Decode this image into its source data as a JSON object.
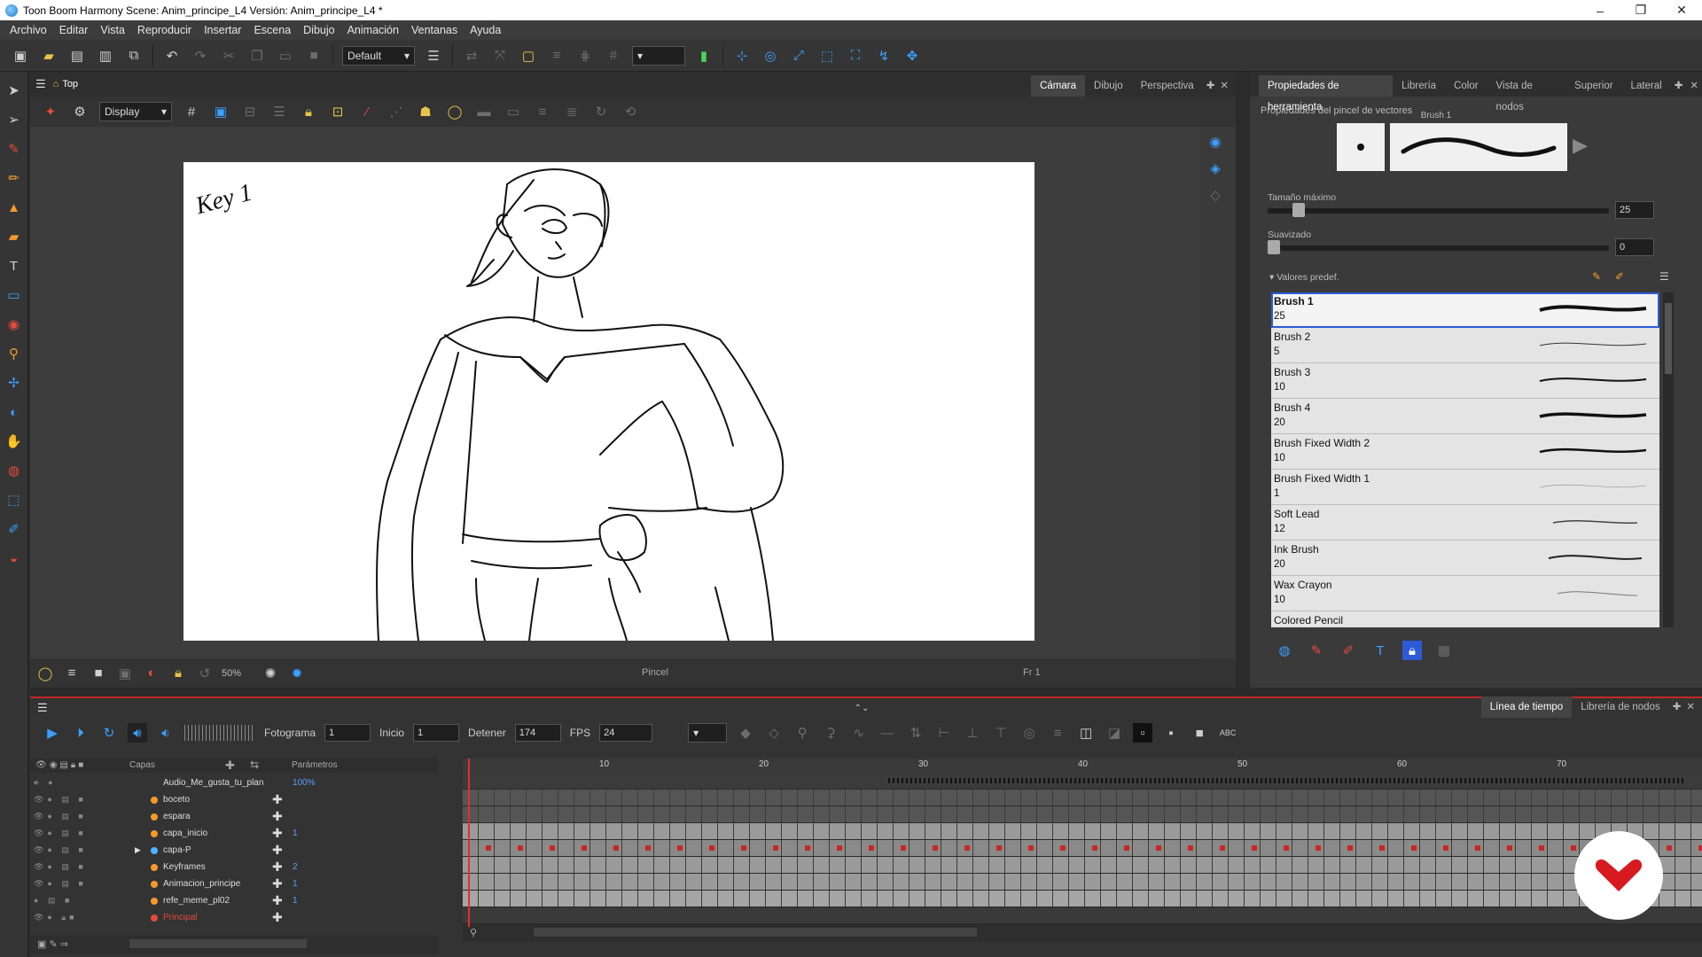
{
  "window": {
    "title": "Toon Boom Harmony Scene: Anim_principe_L4 Versión: Anim_principe_L4 *",
    "min": "–",
    "max": "❐",
    "close": "✕"
  },
  "menu": [
    "Archivo",
    "Editar",
    "Vista",
    "Reproducir",
    "Insertar",
    "Escena",
    "Dibujo",
    "Animación",
    "Ventanas",
    "Ayuda"
  ],
  "toolbar": {
    "workspace_select": "Default"
  },
  "camera": {
    "breadcrumb": "Top",
    "tabs": [
      "Cámara",
      "Dibujo",
      "Perspectiva"
    ],
    "display_select": "Display",
    "zoom": "50%",
    "status_tool": "Pincel",
    "status_frame": "Fr 1",
    "drawing_text": "Key 1"
  },
  "tool_properties": {
    "tabs": [
      "Propiedades de herramienta",
      "Librería",
      "Color",
      "Vista de nodos",
      "Superior",
      "Lateral"
    ],
    "section_title": "Propiedades del pincel de vectores",
    "brush_name": "Brush 1",
    "max_size_label": "Tamaño máximo",
    "max_size_value": "25",
    "smoothing_label": "Suavizado",
    "smoothing_value": "0",
    "presets_label": "Valores predef.",
    "presets": [
      {
        "name": "Brush 1",
        "value": "25"
      },
      {
        "name": "Brush 2",
        "value": "5"
      },
      {
        "name": "Brush 3",
        "value": "10"
      },
      {
        "name": "Brush 4",
        "value": "20"
      },
      {
        "name": "Brush Fixed Width 2",
        "value": "10"
      },
      {
        "name": "Brush Fixed Width 1",
        "value": "1"
      },
      {
        "name": "Soft Lead",
        "value": "12"
      },
      {
        "name": "Ink Brush",
        "value": "20"
      },
      {
        "name": "Wax Crayon",
        "value": "10"
      },
      {
        "name": "Colored Pencil",
        "value": ""
      }
    ]
  },
  "timeline": {
    "tabs": [
      "Línea de tiempo",
      "Librería de nodos"
    ],
    "frame_label": "Fotograma",
    "frame_value": "1",
    "start_label": "Inicio",
    "start_value": "1",
    "stop_label": "Detener",
    "stop_value": "174",
    "fps_label": "FPS",
    "fps_value": "24",
    "layers_header": "Capas",
    "params_header": "Parámetros",
    "ruler_marks": [
      "10",
      "20",
      "30",
      "40",
      "50",
      "60",
      "70"
    ],
    "layers": [
      {
        "name": "Audio_Me_gusta_tu_plan",
        "param": "100%"
      },
      {
        "name": "boceto",
        "param": ""
      },
      {
        "name": "espara",
        "param": ""
      },
      {
        "name": "capa_inicio",
        "param": "1"
      },
      {
        "name": "capa-P",
        "param": ""
      },
      {
        "name": "Keyframes",
        "param": "2"
      },
      {
        "name": "Animacion_principe",
        "param": "1"
      },
      {
        "name": "refe_meme_pl02",
        "param": "1"
      },
      {
        "name": "Principal",
        "param": ""
      }
    ]
  }
}
